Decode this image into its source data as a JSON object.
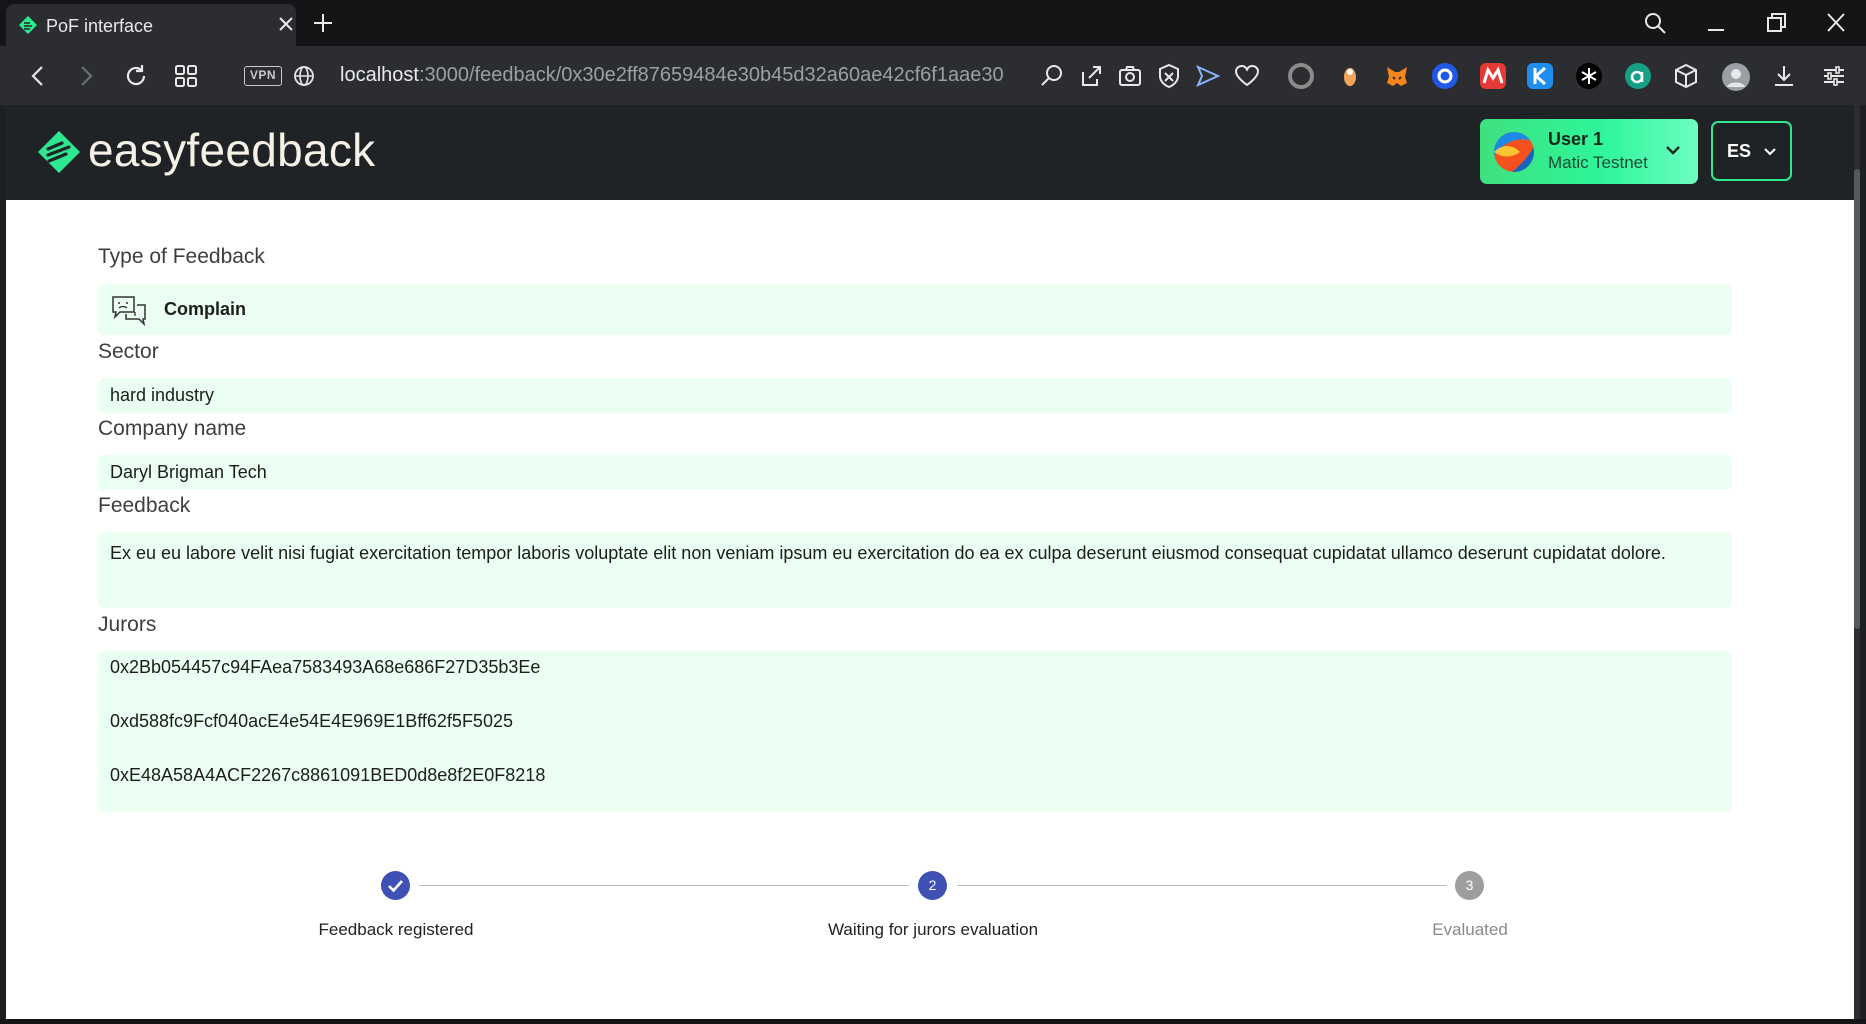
{
  "browser": {
    "tab_title": "PoF interface",
    "vpn_label": "VPN",
    "url_host": "localhost",
    "url_path": ":3000/feedback/0x30e2ff87659484e30b45d32a60ae42cf6f1aae30"
  },
  "header": {
    "brand": "easyfeedback",
    "user_name": "User 1",
    "network": "Matic Testnet",
    "language": "ES"
  },
  "feedback": {
    "type_label": "Type of Feedback",
    "type_value": "Complain",
    "sector_label": "Sector",
    "sector_value": "hard industry",
    "company_label": "Company name",
    "company_value": "Daryl Brigman Tech",
    "feedback_label": "Feedback",
    "feedback_value": "Ex eu eu labore velit nisi fugiat exercitation tempor laboris voluptate elit non veniam ipsum eu exercitation do ea ex culpa deserunt eiusmod consequat cupidatat ullamco deserunt cupidatat dolore.",
    "jurors_label": "Jurors",
    "jurors": [
      "0x2Bb054457c94FAea7583493A68e686F27D35b3Ee",
      "0xd588fc9Fcf040acE4e54E4E969E1Bff62f5F5025",
      "0xE48A58A4ACF2267c8861091BED0d8e8f2E0F8218"
    ]
  },
  "stepper": {
    "steps": [
      {
        "label": "Feedback registered",
        "number": "",
        "state": "done"
      },
      {
        "label": "Waiting for jurors evaluation",
        "number": "2",
        "state": "active"
      },
      {
        "label": "Evaluated",
        "number": "3",
        "state": "pending"
      }
    ]
  },
  "colors": {
    "accent": "#2ee88f",
    "field_bg": "#eafff2",
    "step_active": "#3f51b5",
    "step_pending": "#9e9e9e"
  }
}
